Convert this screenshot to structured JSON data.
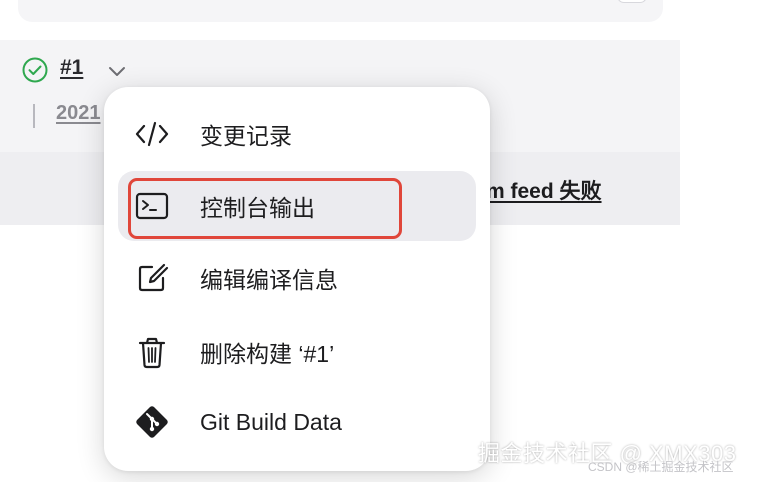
{
  "build": {
    "number": "#1",
    "date_fragment": "2021",
    "commit_message_fragment": "m feed 失败"
  },
  "menu": {
    "items": [
      {
        "label": "变更记录",
        "icon": "code-icon"
      },
      {
        "label": "控制台输出",
        "icon": "terminal-icon"
      },
      {
        "label": "编辑编译信息",
        "icon": "edit-icon"
      },
      {
        "label": "删除构建 ‘#1’",
        "icon": "trash-icon"
      },
      {
        "label": "Git Build Data",
        "icon": "git-icon"
      }
    ],
    "hovered_index": 1
  },
  "watermark": {
    "main": "掘金技术社区 @ XMX303",
    "sub": "CSDN @稀土掘金技术社区"
  },
  "colors": {
    "success": "#2fa84f",
    "highlight_border": "#e0463a",
    "menu_hover": "#ebebef"
  }
}
